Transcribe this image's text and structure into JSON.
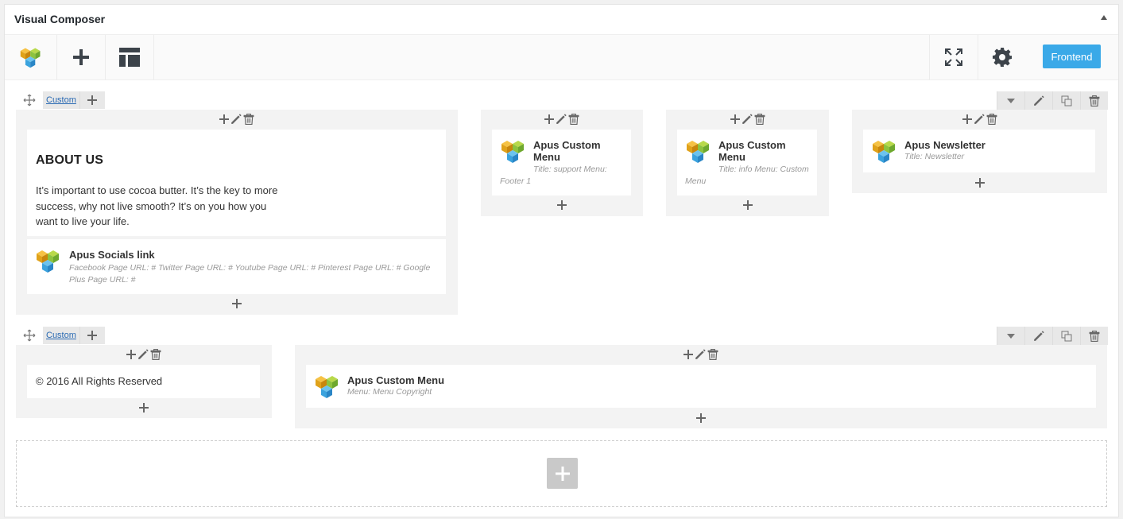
{
  "panel": {
    "title": "Visual Composer"
  },
  "toolbar": {
    "frontend_label": "Frontend"
  },
  "rows": [
    {
      "tab_label": "Custom",
      "columns": [
        {
          "text_block": {
            "heading": "ABOUT US",
            "body": "It’s important to use cocoa butter. It’s the key to more success, why not live smooth? It’s on you how you want to live your life."
          },
          "element": {
            "title": "Apus Socials link",
            "params": "Facebook Page URL: #  Twitter Page URL: #  Youtube Page URL: #  Pinterest Page URL: #  Google Plus Page URL: #"
          }
        },
        {
          "element": {
            "title": "Apus Custom Menu",
            "params": "Title: support  Menu: Footer 1"
          }
        },
        {
          "element": {
            "title": "Apus Custom Menu",
            "params": "Title: info  Menu: Custom Menu"
          }
        },
        {
          "element": {
            "title": "Apus Newsletter",
            "params": "Title: Newsletter"
          }
        }
      ]
    },
    {
      "tab_label": "Custom",
      "columns": [
        {
          "text_block": {
            "body": "© 2016 All Rights Reserved"
          }
        },
        {
          "element": {
            "title": "Apus Custom Menu",
            "params": "Menu: Menu Copyright"
          }
        }
      ]
    }
  ],
  "colors": {
    "accent": "#3aa9e8",
    "link": "#2a6ab3",
    "column_bg": "#f3f3f3"
  }
}
